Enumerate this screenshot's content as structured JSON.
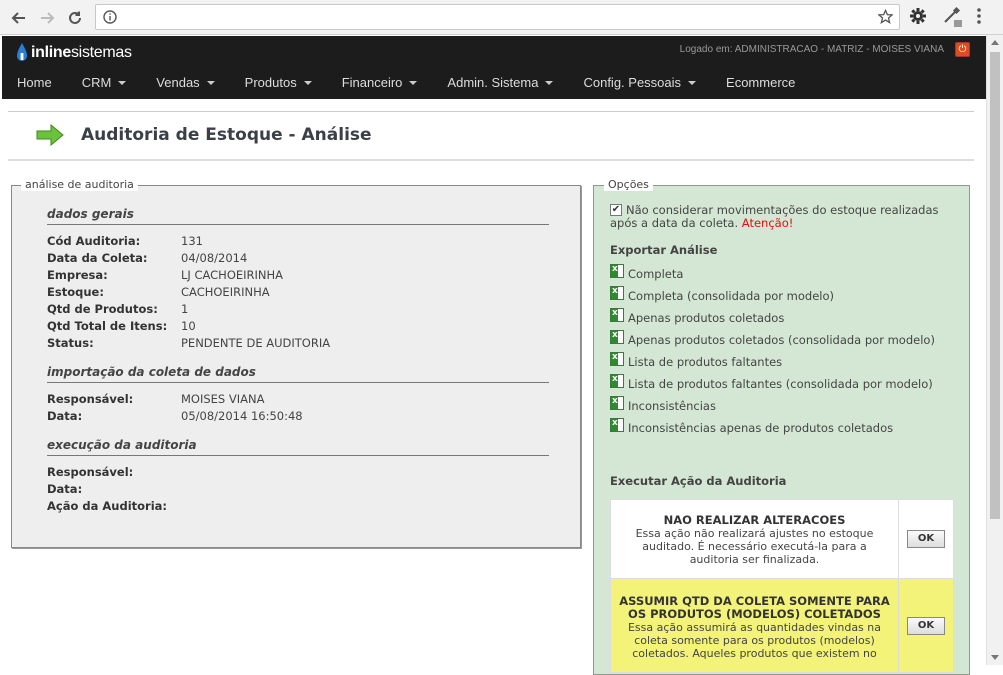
{
  "browser": {
    "url": "",
    "icons": [
      "back-icon",
      "forward-icon",
      "reload-icon",
      "info-icon",
      "star-icon",
      "gear-icon",
      "eyedropper-icon",
      "more-icon"
    ]
  },
  "header": {
    "logo_bold": "inline",
    "logo_rest": "sistemas",
    "logged_in": "Logado em: ADMINISTRACAO - MATRIZ - MOISES VIANA",
    "power_icon": "power-icon",
    "colors": {
      "bar": "#1c1c1c",
      "power": "#e04c1e"
    }
  },
  "menu": {
    "items": [
      {
        "label": "Home",
        "dropdown": false
      },
      {
        "label": "CRM",
        "dropdown": true
      },
      {
        "label": "Vendas",
        "dropdown": true
      },
      {
        "label": "Produtos",
        "dropdown": true
      },
      {
        "label": "Financeiro",
        "dropdown": true
      },
      {
        "label": "Admin. Sistema",
        "dropdown": true
      },
      {
        "label": "Config. Pessoais",
        "dropdown": true
      },
      {
        "label": "Ecommerce",
        "dropdown": false
      }
    ]
  },
  "page": {
    "title": "Auditoria de Estoque - Análise"
  },
  "analysis": {
    "legend": "análise de auditoria",
    "general": {
      "heading": "dados gerais",
      "rows": [
        {
          "k": "Cód Auditoria:",
          "v": "131"
        },
        {
          "k": "Data da Coleta:",
          "v": "04/08/2014"
        },
        {
          "k": "Empresa:",
          "v": "LJ CACHOEIRINHA"
        },
        {
          "k": "Estoque:",
          "v": "CACHOEIRINHA"
        },
        {
          "k": "Qtd de Produtos:",
          "v": "1"
        },
        {
          "k": "Qtd Total de Itens:",
          "v": "10"
        },
        {
          "k": "Status:",
          "v": "PENDENTE DE AUDITORIA"
        }
      ]
    },
    "import": {
      "heading": "importação da coleta de dados",
      "rows": [
        {
          "k": "Responsável:",
          "v": "MOISES VIANA"
        },
        {
          "k": "Data:",
          "v": "05/08/2014 16:50:48"
        }
      ]
    },
    "execution": {
      "heading": "execução da auditoria",
      "rows": [
        {
          "k": "Responsável:",
          "v": ""
        },
        {
          "k": "Data:",
          "v": ""
        },
        {
          "k": "Ação da Auditoria:",
          "v": ""
        }
      ]
    }
  },
  "options": {
    "legend": "Opções",
    "checkbox_checked": true,
    "checkbox_text": "Não considerar movimentações do estoque realizadas após a data da coleta.",
    "warning": "Atenção!",
    "export_heading": "Exportar Análise",
    "export_items": [
      "Completa",
      "Completa (consolidada por modelo)",
      "Apenas produtos coletados",
      "Apenas produtos coletados (consolidada por modelo)",
      "Lista de produtos faltantes",
      "Lista de produtos faltantes (consolidada por modelo)",
      "Inconsistências",
      "Inconsistências apenas de produtos coletados"
    ],
    "exec_heading": "Executar Ação da Auditoria",
    "actions": [
      {
        "title": "NAO REALIZAR ALTERACOES",
        "desc": "Essa ação não realizará ajustes no estoque auditado. É necessário executá-la para a auditoria ser finalizada.",
        "button": "OK"
      },
      {
        "title": "ASSUMIR QTD DA COLETA SOMENTE PARA OS PRODUTOS (MODELOS) COLETADOS",
        "desc": "Essa ação assumirá as quantidades vindas na coleta somente para os produtos (modelos) coletados. Aqueles produtos que existem no",
        "button": "OK"
      }
    ]
  }
}
